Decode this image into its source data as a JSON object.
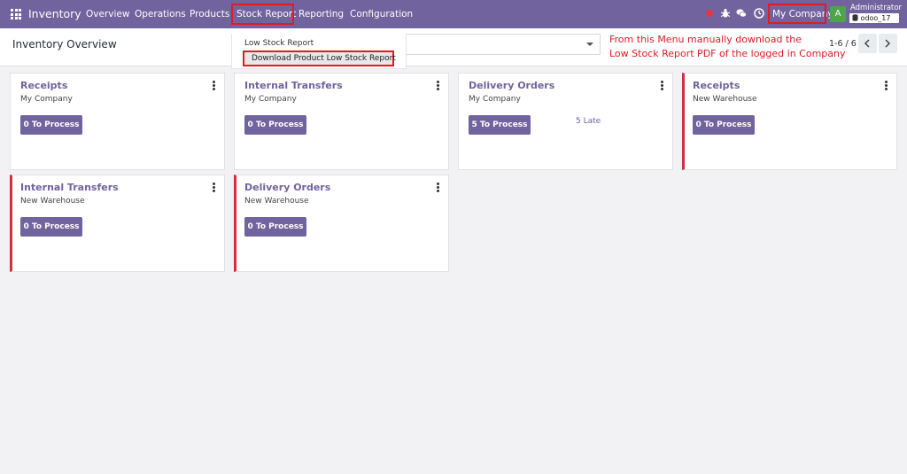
{
  "navbar": {
    "app_name": "Inventory",
    "menus": [
      "Overview",
      "Operations",
      "Products",
      "Stock Report",
      "Reporting",
      "Configuration"
    ],
    "company": "My Company",
    "user_initial": "A",
    "user_name": "Administrator",
    "database": "odoo_17",
    "icons": [
      "apps-grid-icon",
      "record-dot-icon",
      "bug-icon",
      "chat-icon",
      "clock-icon"
    ]
  },
  "control_panel": {
    "title": "Inventory Overview",
    "pager": "1-6 / 6"
  },
  "dropdown": {
    "items": [
      "Low Stock Report",
      "Download Product Low Stock Report"
    ]
  },
  "annotation": {
    "line1": "From this Menu manually download the",
    "line2": "Low Stock Report PDF of the logged in Company"
  },
  "cards": [
    {
      "title": "Receipts",
      "warehouse": "My Company",
      "button": "0 To Process",
      "late": "",
      "alert": false
    },
    {
      "title": "Internal Transfers",
      "warehouse": "My Company",
      "button": "0 To Process",
      "late": "",
      "alert": false
    },
    {
      "title": "Delivery Orders",
      "warehouse": "My Company",
      "button": "5 To Process",
      "late": "5 Late",
      "alert": false
    },
    {
      "title": "Receipts",
      "warehouse": "New Warehouse",
      "button": "0 To Process",
      "late": "",
      "alert": true
    },
    {
      "title": "Internal Transfers",
      "warehouse": "New Warehouse",
      "button": "0 To Process",
      "late": "",
      "alert": true
    },
    {
      "title": "Delivery Orders",
      "warehouse": "New Warehouse",
      "button": "0 To Process",
      "late": "",
      "alert": true
    }
  ],
  "colors": {
    "brand": "#71639e",
    "highlight": "#e01b24",
    "alert_border": "#d0323a",
    "avatar": "#4fa34a"
  }
}
